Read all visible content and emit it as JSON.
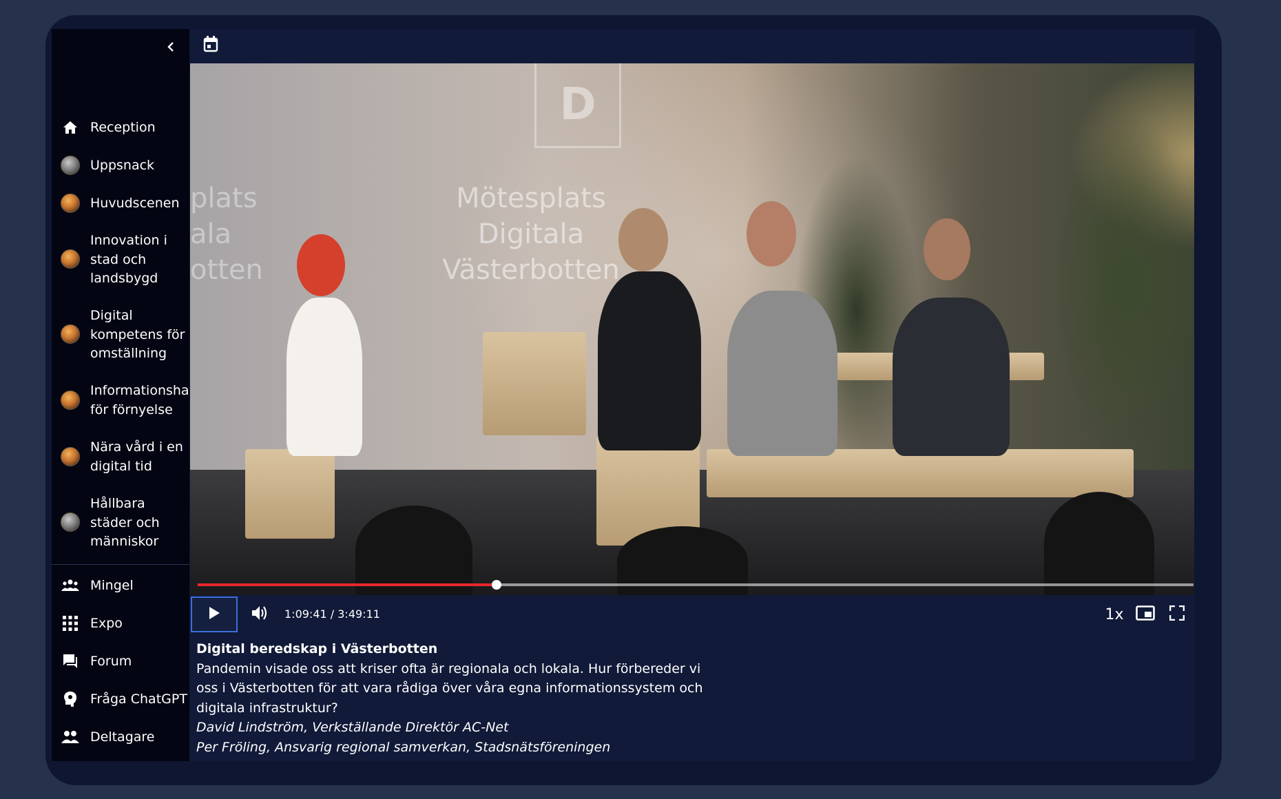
{
  "sidebar": {
    "items": [
      {
        "label": "Reception",
        "icon": "home-icon"
      },
      {
        "label": "Uppsnack",
        "icon": "room-avatar"
      },
      {
        "label": "Huvudscenen",
        "icon": "room-avatar"
      },
      {
        "label": "Innovation i\nstad och\nlandsbygd",
        "icon": "room-avatar"
      },
      {
        "label": "Digital\nkompetens för\nomställning",
        "icon": "room-avatar"
      },
      {
        "label": "Informationshantering\nför förnyelse",
        "icon": "room-avatar"
      },
      {
        "label": "Nära vård i en\ndigital tid",
        "icon": "room-avatar"
      },
      {
        "label": "Hållbara\nstäder och\nmänniskor",
        "icon": "room-avatar"
      },
      {
        "label": "Mingel",
        "icon": "group-icon"
      },
      {
        "label": "Expo",
        "icon": "grid-icon"
      },
      {
        "label": "Forum",
        "icon": "forum-icon"
      },
      {
        "label": "Fråga ChatGPT",
        "icon": "ai-icon"
      },
      {
        "label": "Deltagare",
        "icon": "people-icon"
      }
    ]
  },
  "video": {
    "backdrop_center": "Mötesplats\nDigitala\nVästerbotten",
    "backdrop_left": "plats\nala\notten",
    "logo_letter": "D",
    "progress": 0.3,
    "time": "1:09:41 / 3:49:11",
    "speed": "1x",
    "progress_color": "#e8272d"
  },
  "session": {
    "title": "Digital beredskap i Västerbotten",
    "description": "Pandemin visade oss att kriser ofta är regionala och lokala. Hur förbereder vi oss i Västerbotten för att vara rådiga över våra egna informationssystem och digitala infrastruktur?",
    "speakers": [
      "David Lindström, Verkställande Direktör AC-Net",
      "Per Fröling, Ansvarig regional samverkan, Stadsnätsföreningen"
    ]
  },
  "colors": {
    "page_bg": "#26314c",
    "frame_bg": "#0f1631",
    "sidebar_bg": "#030612",
    "panel_bg": "#111a38",
    "focus_outline": "#3c6fd8"
  }
}
